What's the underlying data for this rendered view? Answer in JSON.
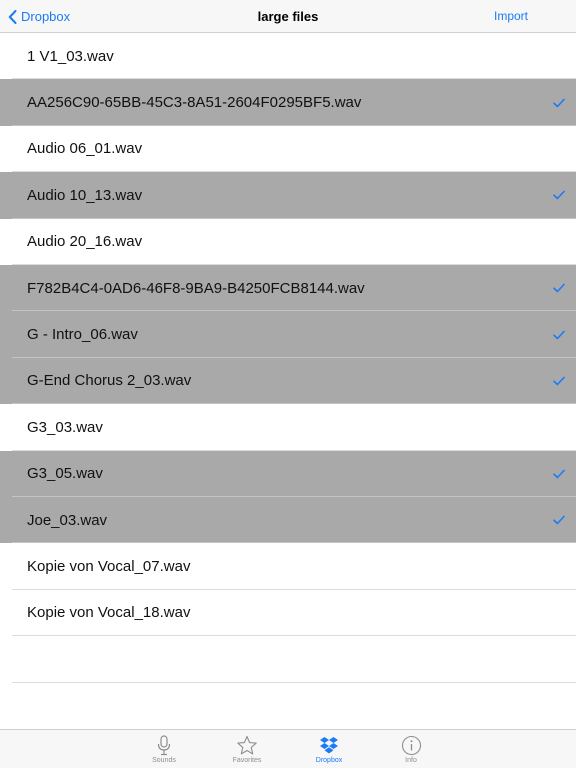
{
  "navbar": {
    "back_label": "Dropbox",
    "title": "large files",
    "import_label": "Import"
  },
  "files": [
    {
      "name": "1 V1_03.wav",
      "selected": false
    },
    {
      "name": "AA256C90-65BB-45C3-8A51-2604F0295BF5.wav",
      "selected": true
    },
    {
      "name": "Audio 06_01.wav",
      "selected": false
    },
    {
      "name": "Audio 10_13.wav",
      "selected": true
    },
    {
      "name": "Audio 20_16.wav",
      "selected": false
    },
    {
      "name": "F782B4C4-0AD6-46F8-9BA9-B4250FCB8144.wav",
      "selected": true
    },
    {
      "name": "G - Intro_06.wav",
      "selected": true
    },
    {
      "name": "G-End Chorus 2_03.wav",
      "selected": true
    },
    {
      "name": "G3_03.wav",
      "selected": false
    },
    {
      "name": "G3_05.wav",
      "selected": true
    },
    {
      "name": "Joe_03.wav",
      "selected": true
    },
    {
      "name": "Kopie von Vocal_07.wav",
      "selected": false
    },
    {
      "name": "Kopie von Vocal_18.wav",
      "selected": false
    }
  ],
  "tabbar": {
    "tabs": [
      {
        "label": "Sounds",
        "icon": "microphone-icon",
        "active": false
      },
      {
        "label": "Favorites",
        "icon": "star-icon",
        "active": false
      },
      {
        "label": "Dropbox",
        "icon": "dropbox-icon",
        "active": true
      },
      {
        "label": "Info",
        "icon": "info-icon",
        "active": false
      }
    ]
  },
  "colors": {
    "accent": "#1a7cf5",
    "selected_row": "#a9a9a9",
    "bar_background": "#f7f7f7"
  }
}
